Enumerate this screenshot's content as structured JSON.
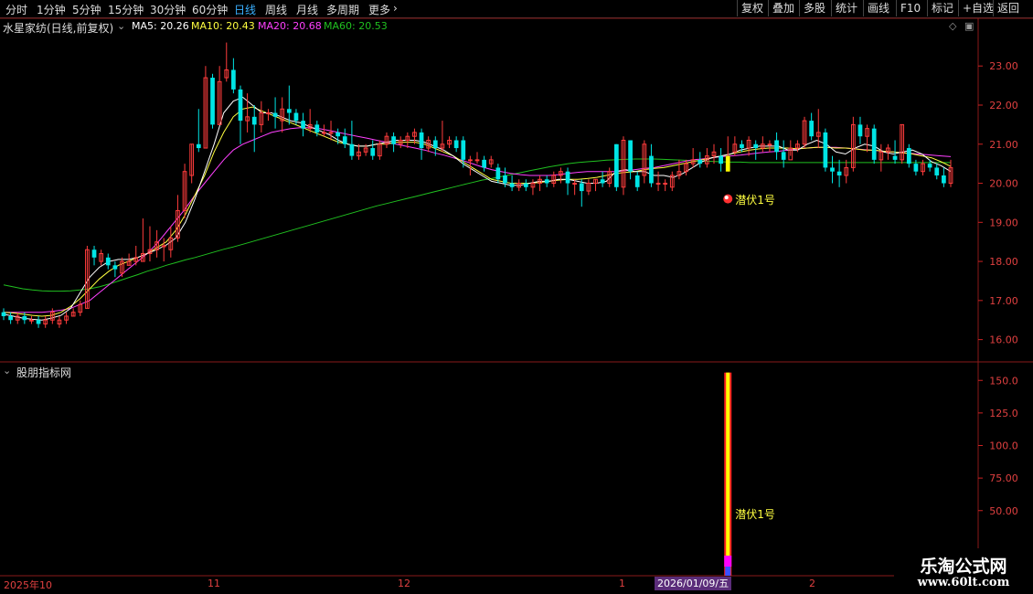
{
  "toolbar": {
    "tabs": [
      "分时",
      "1分钟",
      "5分钟",
      "15分钟",
      "30分钟",
      "60分钟",
      "日线",
      "周线",
      "月线",
      "多周期",
      "更多"
    ],
    "active_tab": "日线",
    "right_buttons": [
      "复权",
      "叠加",
      "多股",
      "统计",
      "画线",
      "F10",
      "标记",
      "+自选",
      "返回"
    ]
  },
  "header": {
    "stock_title": "水星家纺(日线,前复权)",
    "ma5": "MA5: 20.26",
    "ma10": "MA10: 20.43",
    "ma20": "MA20: 20.68",
    "ma60": "MA60: 20.53"
  },
  "colors": {
    "up": "#ff3c3c",
    "down": "#00e5e5",
    "ma5": "#ffffff",
    "ma10": "#ffff40",
    "ma20": "#ff40ff",
    "ma60": "#20c020",
    "signal_bar": "#ffff00"
  },
  "signal": {
    "label_main": "潜伏1号",
    "label_sub": "潜伏1号"
  },
  "sub_panel": {
    "title": "股朋指标网"
  },
  "x_axis": {
    "labels": [
      "2025年10",
      "11",
      "12",
      "1",
      "2"
    ],
    "cursor_date": "2026/01/09/五"
  },
  "watermark": {
    "line1": "乐淘公式网",
    "line2": "www.60lt.com"
  },
  "chart_data": [
    {
      "type": "candlestick",
      "title": "水星家纺(日线,前复权)",
      "ylim": [
        15.5,
        23.8
      ],
      "yticks": [
        16.0,
        17.0,
        18.0,
        19.0,
        20.0,
        21.0,
        22.0,
        23.0
      ],
      "ytick_labels": [
        "16.00",
        "17.00",
        "18.00",
        "19.00",
        "20.00",
        "21.00",
        "22.00",
        "23.00"
      ],
      "candles": [
        [
          16.7,
          16.6,
          16.8,
          16.5
        ],
        [
          16.6,
          16.5,
          16.7,
          16.4
        ],
        [
          16.5,
          16.6,
          16.7,
          16.4
        ],
        [
          16.6,
          16.5,
          16.7,
          16.4
        ],
        [
          16.5,
          16.5,
          16.6,
          16.4
        ],
        [
          16.5,
          16.4,
          16.6,
          16.3
        ],
        [
          16.4,
          16.5,
          16.6,
          16.3
        ],
        [
          16.5,
          16.7,
          16.8,
          16.4
        ],
        [
          16.4,
          16.5,
          16.6,
          16.3
        ],
        [
          16.5,
          16.6,
          16.7,
          16.4
        ],
        [
          16.6,
          16.7,
          16.8,
          16.6
        ],
        [
          16.7,
          16.9,
          17.0,
          16.6
        ],
        [
          16.8,
          18.3,
          18.4,
          16.8
        ],
        [
          18.3,
          18.1,
          18.4,
          17.9
        ],
        [
          18.0,
          18.2,
          18.3,
          17.9
        ],
        [
          18.1,
          17.9,
          18.2,
          17.8
        ],
        [
          17.9,
          17.8,
          18.0,
          17.6
        ],
        [
          17.7,
          18.0,
          18.1,
          17.6
        ],
        [
          17.9,
          18.0,
          18.2,
          17.9
        ],
        [
          18.0,
          18.1,
          18.4,
          17.9
        ],
        [
          18.0,
          18.2,
          19.1,
          18.0
        ],
        [
          18.2,
          18.3,
          18.9,
          18.0
        ],
        [
          18.3,
          18.5,
          18.8,
          18.1
        ],
        [
          18.4,
          18.4,
          18.6,
          18.0
        ],
        [
          18.3,
          18.6,
          18.9,
          18.1
        ],
        [
          18.6,
          19.3,
          19.7,
          18.5
        ],
        [
          19.3,
          20.3,
          20.5,
          19.1
        ],
        [
          20.2,
          21.0,
          21.0,
          20.0
        ],
        [
          21.0,
          20.9,
          21.9,
          20.8
        ],
        [
          20.9,
          22.7,
          23.0,
          20.9
        ],
        [
          22.7,
          21.5,
          22.8,
          21.4
        ],
        [
          21.5,
          22.6,
          23.0,
          21.5
        ],
        [
          22.7,
          22.9,
          23.6,
          22.6
        ],
        [
          22.9,
          22.4,
          23.2,
          22.3
        ],
        [
          22.4,
          21.6,
          22.5,
          21.0
        ],
        [
          21.6,
          21.7,
          22.3,
          21.3
        ],
        [
          21.7,
          21.5,
          22.0,
          20.8
        ],
        [
          21.5,
          21.8,
          22.1,
          21.3
        ],
        [
          21.8,
          21.8,
          21.9,
          21.6
        ],
        [
          21.8,
          21.7,
          22.2,
          21.4
        ],
        [
          21.6,
          21.9,
          22.2,
          21.3
        ],
        [
          21.9,
          21.8,
          22.5,
          21.5
        ],
        [
          21.8,
          21.6,
          21.9,
          21.5
        ],
        [
          21.6,
          21.4,
          21.8,
          21.2
        ],
        [
          21.4,
          21.5,
          21.9,
          21.3
        ],
        [
          21.5,
          21.3,
          21.6,
          21.2
        ],
        [
          21.3,
          21.3,
          21.5,
          21.2
        ],
        [
          21.3,
          21.3,
          21.6,
          21.1
        ],
        [
          21.3,
          21.2,
          21.4,
          21.0
        ],
        [
          21.2,
          21.0,
          21.4,
          20.9
        ],
        [
          21.0,
          20.7,
          21.6,
          20.6
        ],
        [
          20.7,
          20.8,
          21.0,
          20.6
        ],
        [
          20.8,
          20.9,
          21.0,
          20.7
        ],
        [
          20.9,
          20.7,
          21.1,
          20.6
        ],
        [
          20.7,
          21.0,
          21.1,
          20.6
        ],
        [
          21.0,
          21.2,
          21.3,
          20.9
        ],
        [
          21.2,
          21.0,
          21.3,
          20.8
        ],
        [
          21.0,
          21.1,
          21.2,
          20.9
        ],
        [
          21.1,
          21.2,
          21.3,
          20.9
        ],
        [
          21.2,
          21.3,
          21.4,
          21.0
        ],
        [
          21.3,
          20.9,
          21.4,
          20.6
        ],
        [
          20.9,
          21.1,
          21.2,
          20.8
        ],
        [
          21.1,
          20.9,
          21.2,
          20.7
        ],
        [
          20.9,
          21.0,
          21.6,
          20.8
        ],
        [
          21.0,
          21.1,
          21.2,
          20.9
        ],
        [
          21.1,
          20.9,
          21.2,
          20.8
        ],
        [
          21.1,
          20.6,
          21.2,
          20.4
        ],
        [
          20.6,
          20.6,
          20.7,
          20.2
        ],
        [
          20.6,
          20.6,
          20.8,
          20.5
        ],
        [
          20.6,
          20.4,
          20.7,
          20.3
        ],
        [
          20.5,
          20.6,
          20.7,
          20.4
        ],
        [
          20.4,
          20.1,
          20.5,
          20.0
        ],
        [
          20.2,
          20.0,
          20.4,
          19.9
        ],
        [
          20.0,
          19.9,
          20.2,
          19.8
        ],
        [
          19.9,
          20.0,
          20.1,
          19.8
        ],
        [
          20.0,
          19.9,
          20.1,
          19.8
        ],
        [
          19.9,
          20.0,
          20.1,
          19.7
        ],
        [
          20.0,
          20.1,
          20.2,
          19.8
        ],
        [
          20.1,
          20.0,
          20.2,
          19.9
        ],
        [
          20.0,
          20.2,
          20.3,
          19.9
        ],
        [
          20.2,
          20.3,
          20.4,
          20.0
        ],
        [
          20.3,
          20.0,
          20.4,
          19.7
        ],
        [
          20.0,
          20.0,
          20.1,
          19.7
        ],
        [
          20.0,
          19.8,
          20.1,
          19.4
        ],
        [
          19.8,
          20.0,
          20.1,
          19.7
        ],
        [
          20.0,
          20.1,
          20.1,
          19.8
        ],
        [
          20.1,
          20.0,
          20.3,
          19.9
        ],
        [
          20.0,
          20.3,
          20.4,
          19.9
        ],
        [
          21.0,
          19.9,
          21.0,
          19.8
        ],
        [
          19.9,
          21.1,
          21.2,
          19.7
        ],
        [
          21.1,
          20.3,
          21.1,
          20.1
        ],
        [
          20.2,
          19.9,
          20.3,
          19.8
        ],
        [
          20.2,
          21.0,
          21.1,
          20.0
        ],
        [
          20.7,
          20.0,
          21.0,
          19.9
        ],
        [
          20.0,
          20.0,
          20.3,
          19.8
        ],
        [
          20.0,
          20.0,
          20.1,
          19.8
        ],
        [
          19.9,
          20.2,
          20.3,
          19.8
        ],
        [
          20.2,
          20.3,
          20.6,
          20.1
        ],
        [
          20.3,
          20.5,
          20.6,
          20.2
        ],
        [
          20.5,
          20.6,
          20.9,
          20.4
        ],
        [
          20.6,
          20.5,
          20.8,
          20.4
        ],
        [
          20.5,
          20.7,
          20.9,
          20.4
        ],
        [
          20.7,
          20.8,
          21.0,
          20.5
        ],
        [
          20.7,
          20.5,
          20.9,
          20.3
        ],
        [
          20.3,
          20.7,
          21.2,
          20.3
        ],
        [
          20.8,
          21.0,
          21.2,
          20.7
        ],
        [
          21.0,
          20.9,
          21.1,
          20.8
        ],
        [
          20.9,
          21.1,
          21.2,
          20.7
        ],
        [
          21.0,
          20.9,
          21.1,
          20.6
        ],
        [
          20.9,
          21.0,
          21.2,
          20.8
        ],
        [
          21.0,
          21.0,
          21.1,
          20.8
        ],
        [
          21.1,
          20.8,
          21.3,
          20.6
        ],
        [
          20.8,
          20.6,
          21.1,
          20.4
        ],
        [
          20.6,
          20.9,
          21.1,
          20.7
        ],
        [
          20.9,
          21.0,
          21.1,
          20.8
        ],
        [
          21.0,
          21.6,
          21.7,
          20.9
        ],
        [
          21.6,
          21.2,
          21.8,
          21.1
        ],
        [
          21.2,
          21.3,
          21.9,
          20.9
        ],
        [
          21.3,
          20.4,
          21.4,
          20.3
        ],
        [
          20.4,
          20.3,
          20.7,
          20.0
        ],
        [
          20.3,
          20.2,
          20.6,
          19.9
        ],
        [
          20.2,
          20.4,
          20.6,
          20.0
        ],
        [
          20.4,
          21.5,
          21.7,
          20.3
        ],
        [
          21.5,
          21.2,
          21.7,
          21.0
        ],
        [
          21.2,
          21.4,
          21.5,
          20.8
        ],
        [
          21.4,
          20.6,
          21.5,
          20.5
        ],
        [
          20.6,
          20.8,
          21.0,
          20.3
        ],
        [
          20.8,
          20.9,
          21.0,
          20.6
        ],
        [
          20.7,
          20.6,
          21.1,
          20.5
        ],
        [
          20.6,
          21.5,
          21.5,
          20.5
        ],
        [
          20.9,
          20.5,
          21.0,
          20.4
        ],
        [
          20.5,
          20.3,
          20.6,
          20.2
        ],
        [
          20.3,
          20.5,
          20.6,
          20.2
        ],
        [
          20.5,
          20.4,
          20.6,
          20.3
        ],
        [
          20.4,
          20.2,
          20.5,
          20.1
        ],
        [
          20.2,
          20.0,
          20.4,
          19.9
        ],
        [
          20.0,
          20.4,
          20.6,
          19.9
        ]
      ],
      "ma5": [
        16.65,
        16.6,
        16.55,
        16.52,
        16.5,
        16.55,
        16.62,
        16.8,
        17.2,
        17.6,
        17.85,
        18.0,
        18.05,
        18.05,
        18.1,
        18.2,
        18.3,
        18.42,
        18.6,
        19.0,
        19.6,
        20.3,
        21.0,
        21.8,
        22.1,
        22.2,
        22.0,
        21.8,
        21.8,
        21.7,
        21.6,
        21.55,
        21.45,
        21.35,
        21.25,
        21.1,
        21.0,
        20.95,
        20.95,
        21.0,
        21.05,
        21.1,
        21.1,
        21.1,
        21.05,
        20.95,
        20.85,
        20.7,
        20.5,
        20.35,
        20.2,
        20.05,
        20.0,
        19.95,
        19.95,
        20.0,
        20.05,
        20.05,
        20.1,
        20.1,
        20.05,
        20.0,
        20.0,
        20.05,
        20.3,
        20.35,
        20.3,
        20.3,
        20.2,
        20.2,
        20.15,
        20.25,
        20.4,
        20.55,
        20.65,
        20.7,
        20.75,
        20.85,
        20.9,
        20.95,
        20.95,
        20.95,
        20.85,
        20.85,
        21.0,
        21.1,
        21.0,
        20.8,
        20.75,
        20.9,
        21.0,
        20.95,
        20.8,
        20.75,
        20.8,
        20.85,
        20.75,
        20.55,
        20.45,
        20.3
      ],
      "ma10": [
        16.7,
        16.68,
        16.65,
        16.62,
        16.6,
        16.62,
        16.7,
        16.85,
        17.05,
        17.3,
        17.55,
        17.75,
        17.9,
        18.0,
        18.1,
        18.2,
        18.35,
        18.5,
        18.8,
        19.2,
        19.7,
        20.2,
        20.8,
        21.3,
        21.7,
        21.9,
        21.95,
        21.85,
        21.75,
        21.65,
        21.55,
        21.45,
        21.35,
        21.25,
        21.15,
        21.05,
        21.0,
        20.95,
        20.95,
        21.0,
        21.0,
        21.05,
        21.05,
        21.05,
        21.0,
        20.9,
        20.8,
        20.7,
        20.55,
        20.4,
        20.25,
        20.1,
        20.05,
        20.0,
        20.0,
        20.0,
        20.02,
        20.05,
        20.08,
        20.1,
        20.1,
        20.12,
        20.15,
        20.2,
        20.25,
        20.28,
        20.3,
        20.35,
        20.38,
        20.4,
        20.45,
        20.5,
        20.55,
        20.6,
        20.65,
        20.7,
        20.75,
        20.8,
        20.85,
        20.88,
        20.9,
        20.9,
        20.9,
        20.88,
        20.9,
        20.92,
        20.92,
        20.9,
        20.9,
        20.88,
        20.85,
        20.85,
        20.82,
        20.8,
        20.78,
        20.75,
        20.7,
        20.65,
        20.55,
        20.43
      ],
      "ma20": [
        16.7,
        16.7,
        16.7,
        16.7,
        16.7,
        16.72,
        16.75,
        16.8,
        16.9,
        17.0,
        17.2,
        17.4,
        17.6,
        17.8,
        18.0,
        18.2,
        18.45,
        18.75,
        19.05,
        19.35,
        19.7,
        20.0,
        20.3,
        20.6,
        20.85,
        21.0,
        21.1,
        21.2,
        21.3,
        21.35,
        21.4,
        21.42,
        21.42,
        21.4,
        21.35,
        21.3,
        21.25,
        21.2,
        21.15,
        21.1,
        21.05,
        21.0,
        20.95,
        20.9,
        20.85,
        20.78,
        20.72,
        20.65,
        20.58,
        20.5,
        20.42,
        20.35,
        20.3,
        20.25,
        20.22,
        20.2,
        20.2,
        20.2,
        20.22,
        20.25,
        20.28,
        20.3,
        20.3,
        20.3,
        20.3,
        20.32,
        20.35,
        20.38,
        20.4,
        20.45,
        20.5,
        20.55,
        20.6,
        20.62,
        20.65,
        20.68,
        20.7,
        20.72,
        20.75,
        20.78,
        20.8,
        20.82,
        20.85,
        20.88,
        20.9,
        20.92,
        20.92,
        20.92,
        20.9,
        20.88,
        20.86,
        20.84,
        20.82,
        20.8,
        20.78,
        20.76,
        20.74,
        20.72,
        20.7,
        20.68
      ],
      "ma60": [
        17.4,
        17.35,
        17.3,
        17.27,
        17.25,
        17.24,
        17.24,
        17.25,
        17.27,
        17.3,
        17.35,
        17.42,
        17.5,
        17.58,
        17.66,
        17.75,
        17.82,
        17.9,
        17.97,
        18.04,
        18.1,
        18.17,
        18.24,
        18.31,
        18.37,
        18.44,
        18.51,
        18.58,
        18.65,
        18.72,
        18.79,
        18.86,
        18.93,
        19.0,
        19.07,
        19.14,
        19.21,
        19.28,
        19.35,
        19.42,
        19.48,
        19.54,
        19.6,
        19.66,
        19.72,
        19.78,
        19.84,
        19.9,
        19.96,
        20.02,
        20.08,
        20.12,
        20.17,
        20.22,
        20.27,
        20.32,
        20.37,
        20.42,
        20.46,
        20.5,
        20.53,
        20.55,
        20.57,
        20.59,
        20.6,
        20.61,
        20.62,
        20.62,
        20.62,
        20.61,
        20.6,
        20.59,
        20.58,
        20.57,
        20.56,
        20.55,
        20.54,
        20.54,
        20.53,
        20.53,
        20.53,
        20.53,
        20.53,
        20.53,
        20.53,
        20.53,
        20.53,
        20.53,
        20.53,
        20.53,
        20.53,
        20.53,
        20.53,
        20.53,
        20.53,
        20.53,
        20.53,
        20.53,
        20.53,
        20.53
      ],
      "signal_index": 104
    },
    {
      "type": "bar",
      "title": "股朋指标网",
      "ylim": [
        0,
        160
      ],
      "yticks": [
        50,
        75,
        100,
        125,
        150
      ],
      "ytick_labels": [
        "50.00",
        "75.00",
        "100.0",
        "125.0",
        "150.0"
      ],
      "bars": [
        {
          "x": "2026/01/09",
          "value": 156
        }
      ]
    }
  ]
}
